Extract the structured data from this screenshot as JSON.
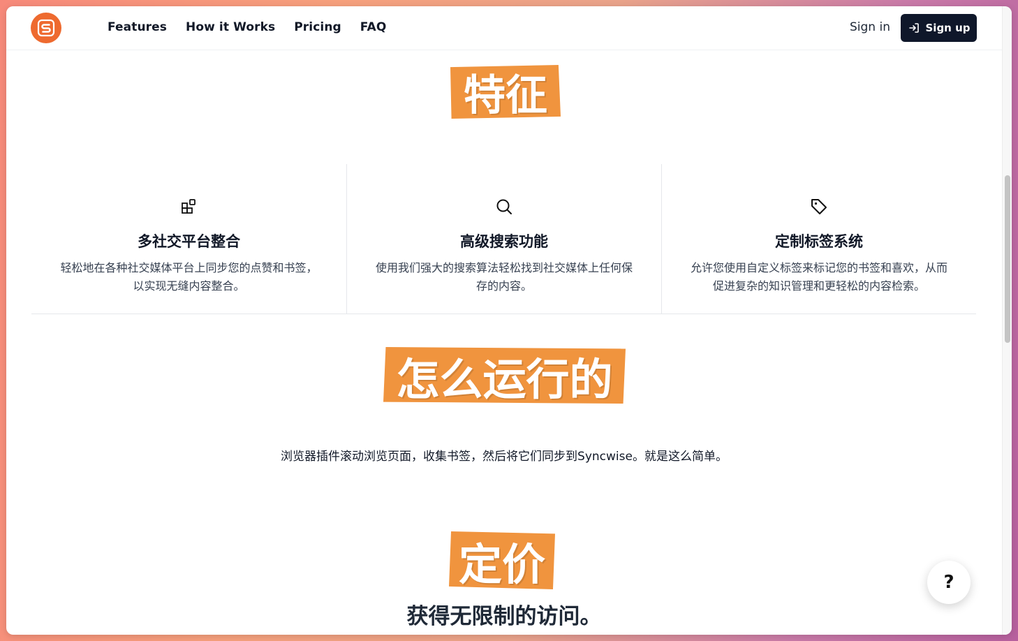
{
  "nav": {
    "items": [
      "Features",
      "How it Works",
      "Pricing",
      "FAQ"
    ],
    "sign_in": "Sign in",
    "sign_up": "Sign up"
  },
  "features": {
    "title": "特征",
    "items": [
      {
        "icon": "blocks-icon",
        "title": "多社交平台整合",
        "desc": "轻松地在各种社交媒体平台上同步您的点赞和书签，以实现无缝内容整合。"
      },
      {
        "icon": "search-icon",
        "title": "高级搜索功能",
        "desc": "使用我们强大的搜索算法轻松找到社交媒体上任何保存的内容。"
      },
      {
        "icon": "tag-icon",
        "title": "定制标签系统",
        "desc": "允许您使用自定义标签来标记您的书签和喜欢，从而促进复杂的知识管理和更轻松的内容检索。"
      }
    ]
  },
  "how": {
    "title": "怎么运行的",
    "desc": "浏览器插件滚动浏览页面，收集书签，然后将它们同步到Syncwise。就是这么简单。"
  },
  "pricing": {
    "title": "定价",
    "subtitle": "获得无限制的访问。"
  },
  "help": {
    "label": "?"
  },
  "colors": {
    "accent": "#f0943e",
    "logo": "#ee6a2f",
    "button": "#0f172a"
  }
}
